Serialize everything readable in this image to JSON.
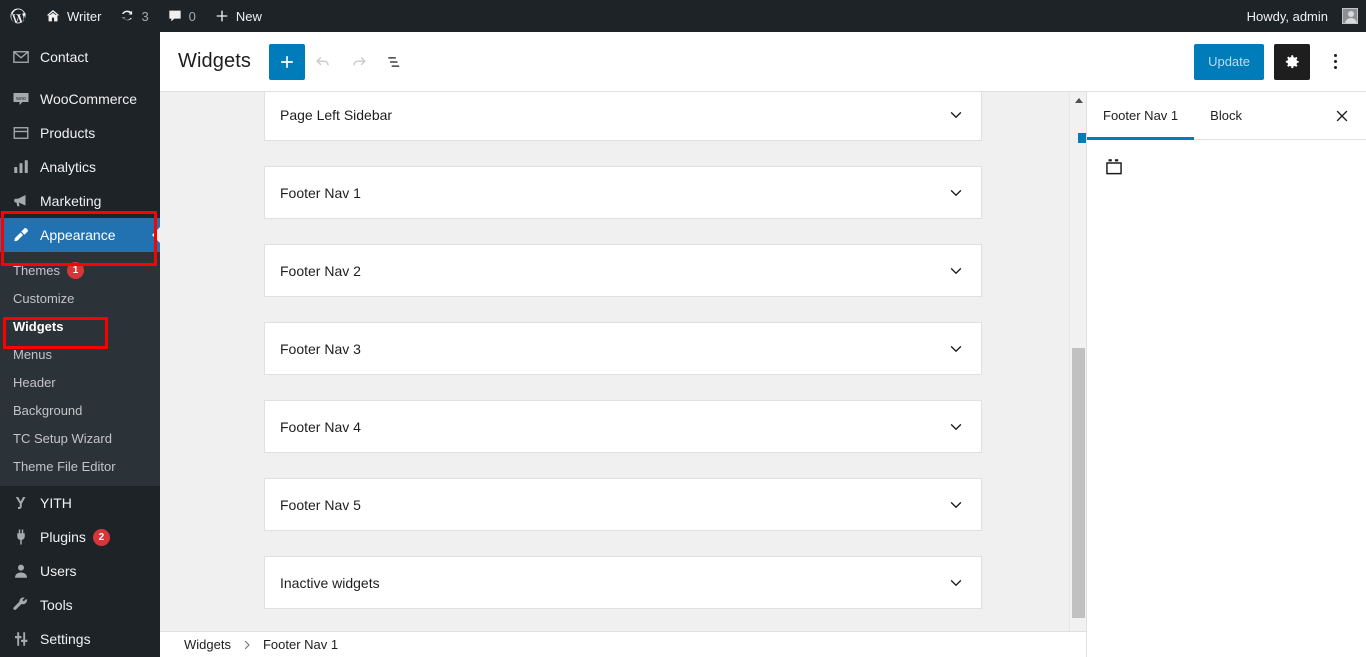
{
  "adminbar": {
    "wp_logo": "wordpress-logo-icon",
    "site_name": "Writer",
    "updates_count": "3",
    "comments_count": "0",
    "new_label": "New",
    "howdy": "Howdy, admin"
  },
  "sidebar": {
    "items": [
      {
        "label": "Contact",
        "icon": "mail-icon",
        "id": "contact"
      },
      {
        "label": "WooCommerce",
        "icon": "woo-icon",
        "id": "woocommerce"
      },
      {
        "label": "Products",
        "icon": "products-icon",
        "id": "products"
      },
      {
        "label": "Analytics",
        "icon": "chart-bars-icon",
        "id": "analytics"
      },
      {
        "label": "Marketing",
        "icon": "megaphone-icon",
        "id": "marketing"
      },
      {
        "label": "Appearance",
        "icon": "paintbrush-icon",
        "id": "appearance",
        "current": true
      },
      {
        "label": "YITH",
        "icon": "yith-icon",
        "id": "yith"
      },
      {
        "label": "Plugins",
        "icon": "plug-icon",
        "id": "plugins",
        "badge": "2"
      },
      {
        "label": "Users",
        "icon": "user-icon",
        "id": "users"
      },
      {
        "label": "Tools",
        "icon": "wrench-icon",
        "id": "tools"
      },
      {
        "label": "Settings",
        "icon": "sliders-icon",
        "id": "settings"
      }
    ],
    "submenu": [
      {
        "label": "Themes",
        "badge": "1",
        "id": "themes"
      },
      {
        "label": "Customize",
        "id": "customize"
      },
      {
        "label": "Widgets",
        "id": "widgets",
        "current": true
      },
      {
        "label": "Menus",
        "id": "menus"
      },
      {
        "label": "Header",
        "id": "header"
      },
      {
        "label": "Background",
        "id": "background"
      },
      {
        "label": "TC Setup Wizard",
        "id": "tc-setup-wizard"
      },
      {
        "label": "Theme File Editor",
        "id": "theme-file-editor"
      }
    ]
  },
  "editor_header": {
    "title": "Widgets",
    "add_block_label": "+",
    "undo_label": "undo-icon",
    "redo_label": "redo-icon",
    "list_view_label": "list-view-icon",
    "update_label": "Update",
    "settings_label": "settings-gear-icon",
    "more_label": "more-options-icon"
  },
  "canvas": {
    "panels": [
      {
        "label": "Page Left Sidebar"
      },
      {
        "label": "Footer Nav 1"
      },
      {
        "label": "Footer Nav 2"
      },
      {
        "label": "Footer Nav 3"
      },
      {
        "label": "Footer Nav 4"
      },
      {
        "label": "Footer Nav 5"
      },
      {
        "label": "Inactive widgets"
      }
    ]
  },
  "inspector": {
    "tabs": [
      {
        "label": "Footer Nav 1",
        "active": true
      },
      {
        "label": "Block",
        "active": false
      }
    ],
    "close_label": "close-icon",
    "body_icon": "widget-area-icon"
  },
  "breadcrumb": {
    "root": "Widgets",
    "separator": "›",
    "current": "Footer Nav 1"
  },
  "colors": {
    "admin_bar": "#1d2327",
    "sidebar": "#1d2327",
    "submenu": "#2c3338",
    "current_menu": "#2271b1",
    "accent": "#007cba",
    "annotation": "#ff0000",
    "badge": "#d63638",
    "canvas": "#f0f0f1"
  }
}
